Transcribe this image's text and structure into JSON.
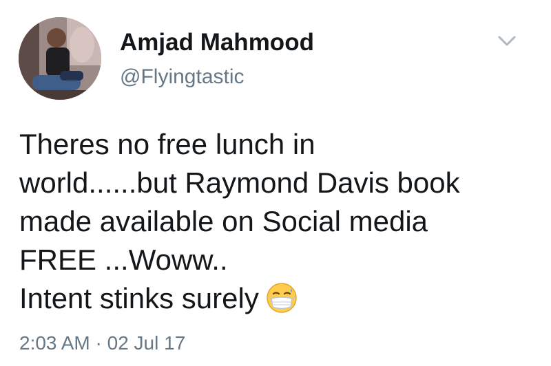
{
  "author": {
    "name": "Amjad Mahmood",
    "handle": "@Flyingtastic"
  },
  "tweet": {
    "lines": [
      "Theres no free lunch in",
      "world......but Raymond Davis book",
      "made available on Social media",
      "FREE ...Woww..",
      "Intent stinks surely"
    ],
    "emoji": "face-with-medical-mask-icon",
    "time": "2:03 AM",
    "separator": "·",
    "date": "02 Jul 17"
  },
  "colors": {
    "text": "#14171a",
    "secondary": "#657786",
    "chevron": "#aab8c2",
    "background": "#ffffff"
  },
  "icons": {
    "menu": "chevron-down-icon",
    "avatar": "profile-photo"
  }
}
